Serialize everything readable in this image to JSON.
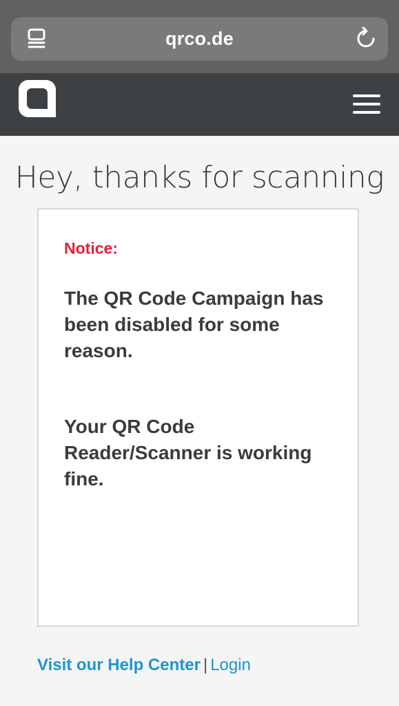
{
  "browser": {
    "url": "qrco.de",
    "tabs_icon": "tabs-icon",
    "reload_icon": "reload-icon"
  },
  "header": {
    "logo_icon": "logo-icon",
    "menu_icon": "hamburger-menu-icon",
    "background_color": "#3e4144"
  },
  "main": {
    "title": "Hey, thanks for scanning",
    "notice_label": "Notice:",
    "notice_text_1": "The QR Code Campaign has been disabled for some reason.",
    "notice_text_2": "Your QR Code Reader/Scanner is working fine.",
    "notice_label_color": "#e0213a"
  },
  "footer": {
    "help_link": "Visit our Help Center",
    "separator": "|",
    "login_link": "Login",
    "link_color": "#1a96d1"
  }
}
